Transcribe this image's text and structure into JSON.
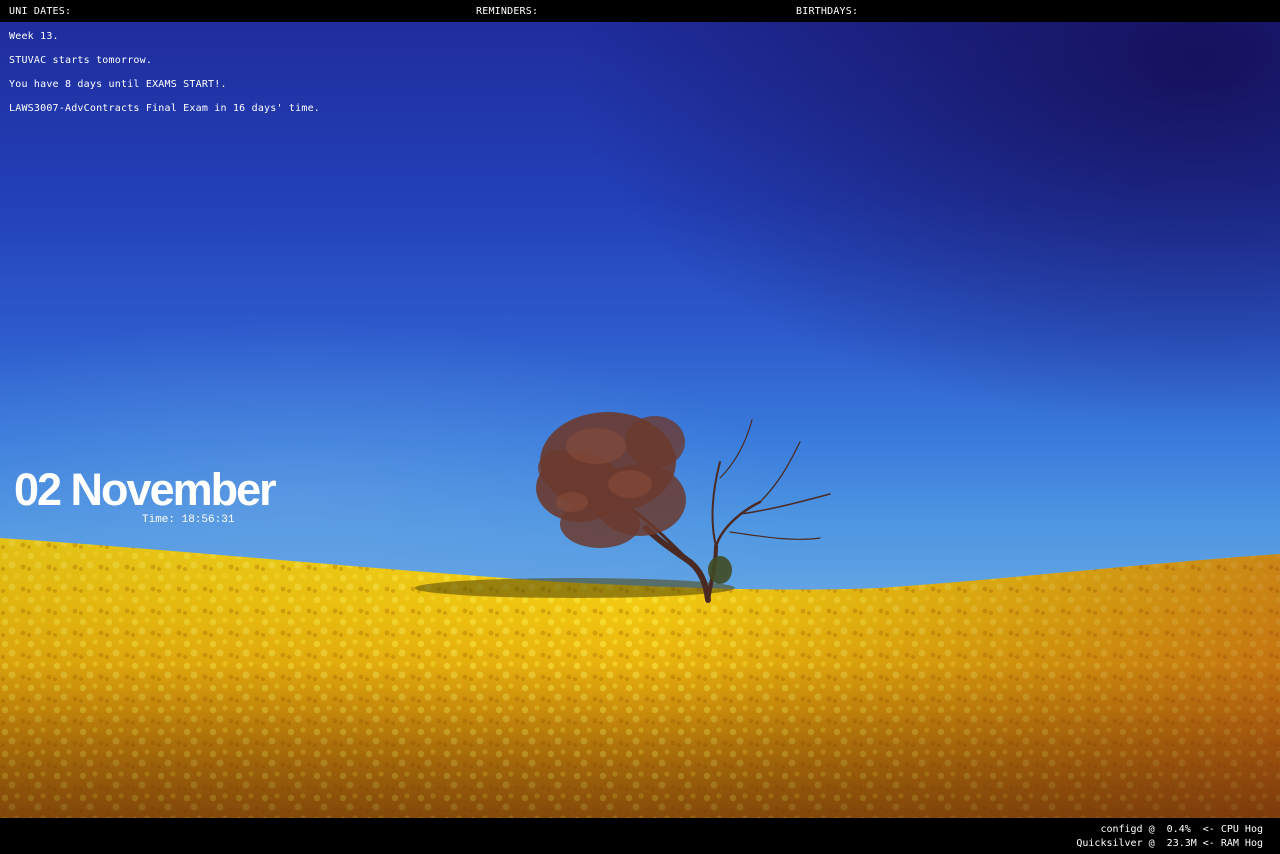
{
  "top_bar": {
    "uni_dates_label": "UNI DATES:",
    "reminders_label": "REMINDERS:",
    "birthdays_label": "BIRTHDAYS:"
  },
  "uni_dates": [
    "Week 13.",
    "STUVAC starts tomorrow.",
    "You have 8 days until EXAMS START!.",
    "LAWS3007-AdvContracts Final Exam in 16 days' time."
  ],
  "clock": {
    "date": "02 November",
    "time": "Time: 18:56:31"
  },
  "system_monitor": {
    "cpu_line": "configd @  0.4%  <- CPU Hog",
    "ram_line": "Quicksilver @  23.3M <- RAM Hog"
  },
  "colors": {
    "sky_top": "#1f2d9d",
    "sky_horizon": "#6aa9e4",
    "field_yellow": "#f2c811",
    "field_deep": "#b8740a",
    "tree_foliage": "#6b3a2e"
  },
  "wallpaper": {
    "subject": "lone-tree-in-canola-field"
  }
}
